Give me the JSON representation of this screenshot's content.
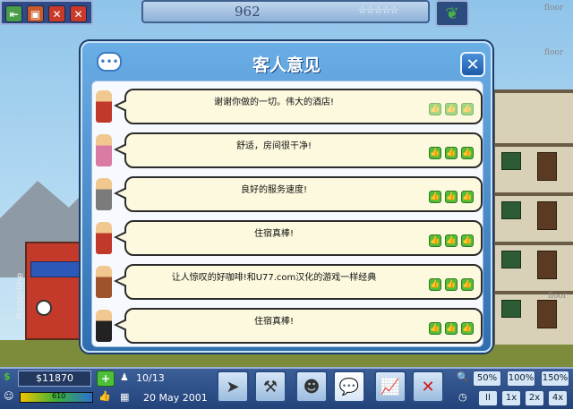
{
  "top_bar": {
    "score": "962",
    "stars": "☆☆☆☆☆"
  },
  "dialog": {
    "title": "客人意见",
    "comments": [
      {
        "text": "谢谢你做的一切。伟大的酒店!",
        "rating": 3,
        "rating_faded": true
      },
      {
        "text": "舒适，房间很干净!",
        "rating": 3,
        "rating_faded": false
      },
      {
        "text": "良好的服务速度!",
        "rating": 3,
        "rating_faded": false
      },
      {
        "text": "住宿真棒!",
        "rating": 3,
        "rating_faded": false
      },
      {
        "text": "让人惊叹的好咖啡!和U77.com汉化的游戏一样经典",
        "rating": 3,
        "rating_faded": false
      },
      {
        "text": "住宿真棒!",
        "rating": 3,
        "rating_faded": false
      }
    ]
  },
  "status": {
    "money": "$11870",
    "guests": "10/13",
    "date": "20 May 2001",
    "satisfaction_label": "610"
  },
  "zoom_options": [
    "50%",
    "100%",
    "150%"
  ],
  "speed_options": [
    "II",
    "1x",
    "2x",
    "4x"
  ],
  "building": {
    "floor_label": "floor",
    "side_text": "Roderline"
  },
  "colors": {
    "accent": "#2f6db0",
    "bubble": "#fdf9de",
    "thumb": "#4fbf3a"
  }
}
